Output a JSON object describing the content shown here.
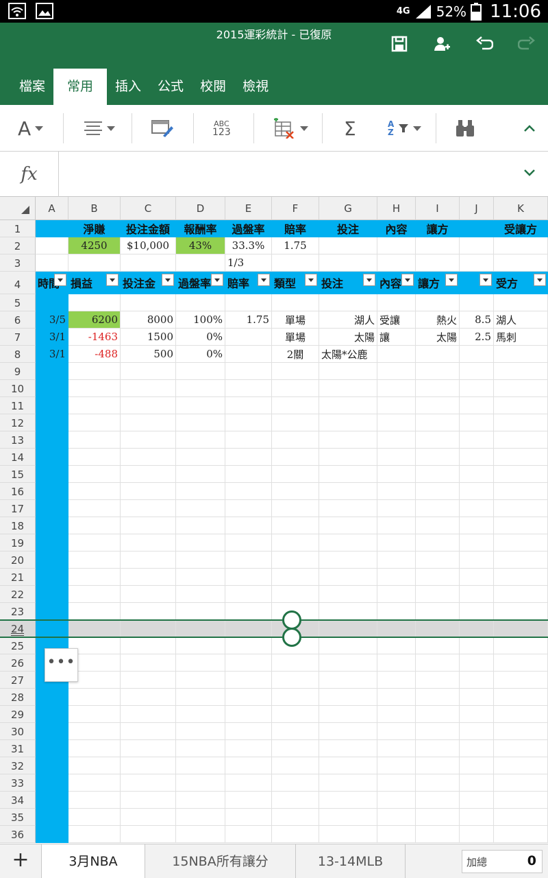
{
  "status_bar": {
    "network": "4G",
    "battery": "52%",
    "time": "11:06"
  },
  "title_bar": {
    "title": "2015運彩統計 - 已復原"
  },
  "ribbon": {
    "tabs": [
      "檔案",
      "常用",
      "插入",
      "公式",
      "校閱",
      "檢視"
    ],
    "active_tab": "常用"
  },
  "toolbar": {
    "font_label": "A",
    "spell_label_top": "ABC",
    "spell_label_bottom": "123",
    "sum_label": "Σ",
    "sort_label_top": "A",
    "sort_label_bottom": "Z"
  },
  "formula_bar": {
    "fx_label": "fx",
    "value": ""
  },
  "columns": [
    "A",
    "B",
    "C",
    "D",
    "E",
    "F",
    "G",
    "H",
    "I",
    "J",
    "K"
  ],
  "rows": [
    "1",
    "2",
    "3",
    "4",
    "5",
    "6",
    "7",
    "8",
    "9",
    "10",
    "11",
    "12",
    "13",
    "14",
    "15",
    "16",
    "17",
    "18",
    "19",
    "20",
    "21",
    "22",
    "23",
    "24",
    "25",
    "26",
    "27",
    "28",
    "29",
    "30",
    "31",
    "32",
    "33",
    "34",
    "35",
    "36"
  ],
  "cells": {
    "r1": {
      "b": "淨賺",
      "c": "投注金額",
      "d": "報酬率",
      "e": "過盤率",
      "f": "賠率",
      "g": "投注",
      "h": "內容",
      "i": "讓方",
      "k": "受讓方"
    },
    "r2": {
      "b": "4250",
      "c": "$10,000",
      "d": "43%",
      "e": "33.3%",
      "f": "1.75"
    },
    "r3": {
      "e": "1/3"
    },
    "r4": {
      "a": "時間",
      "b": "損益",
      "c": "投注金",
      "d": "過盤率",
      "e": "賠率",
      "f": "類型",
      "g": "投注",
      "h": "內容",
      "i": "讓方",
      "j": "",
      "k": "受方"
    },
    "r6": {
      "a": "3/5",
      "b": "6200",
      "c": "8000",
      "d": "100%",
      "e": "1.75",
      "f": "單場",
      "g": "湖人",
      "h": "受讓",
      "i": "熱火",
      "j": "8.5",
      "k": "湖人"
    },
    "r7": {
      "a": "3/1",
      "b": "-1463",
      "c": "1500",
      "d": "0%",
      "f": "單場",
      "g": "太陽",
      "h": "讓",
      "i": "太陽",
      "j": "2.5",
      "k": "馬刺"
    },
    "r8": {
      "a": "3/1",
      "b": "-488",
      "c": "500",
      "d": "0%",
      "f": "2關",
      "g": "太陽*公鹿"
    }
  },
  "context_menu_label": "•••",
  "sheets": {
    "add_label": "+",
    "tabs": [
      "3月NBA",
      "15NBA所有讓分",
      "13-14MLB"
    ],
    "active": "3月NBA"
  },
  "summary": {
    "label": "加總",
    "value": "0"
  },
  "colors": {
    "excel_green": "#217346",
    "header_blue": "#00b0f0",
    "highlight_green": "#92d050",
    "negative_red": "#dd2222"
  }
}
